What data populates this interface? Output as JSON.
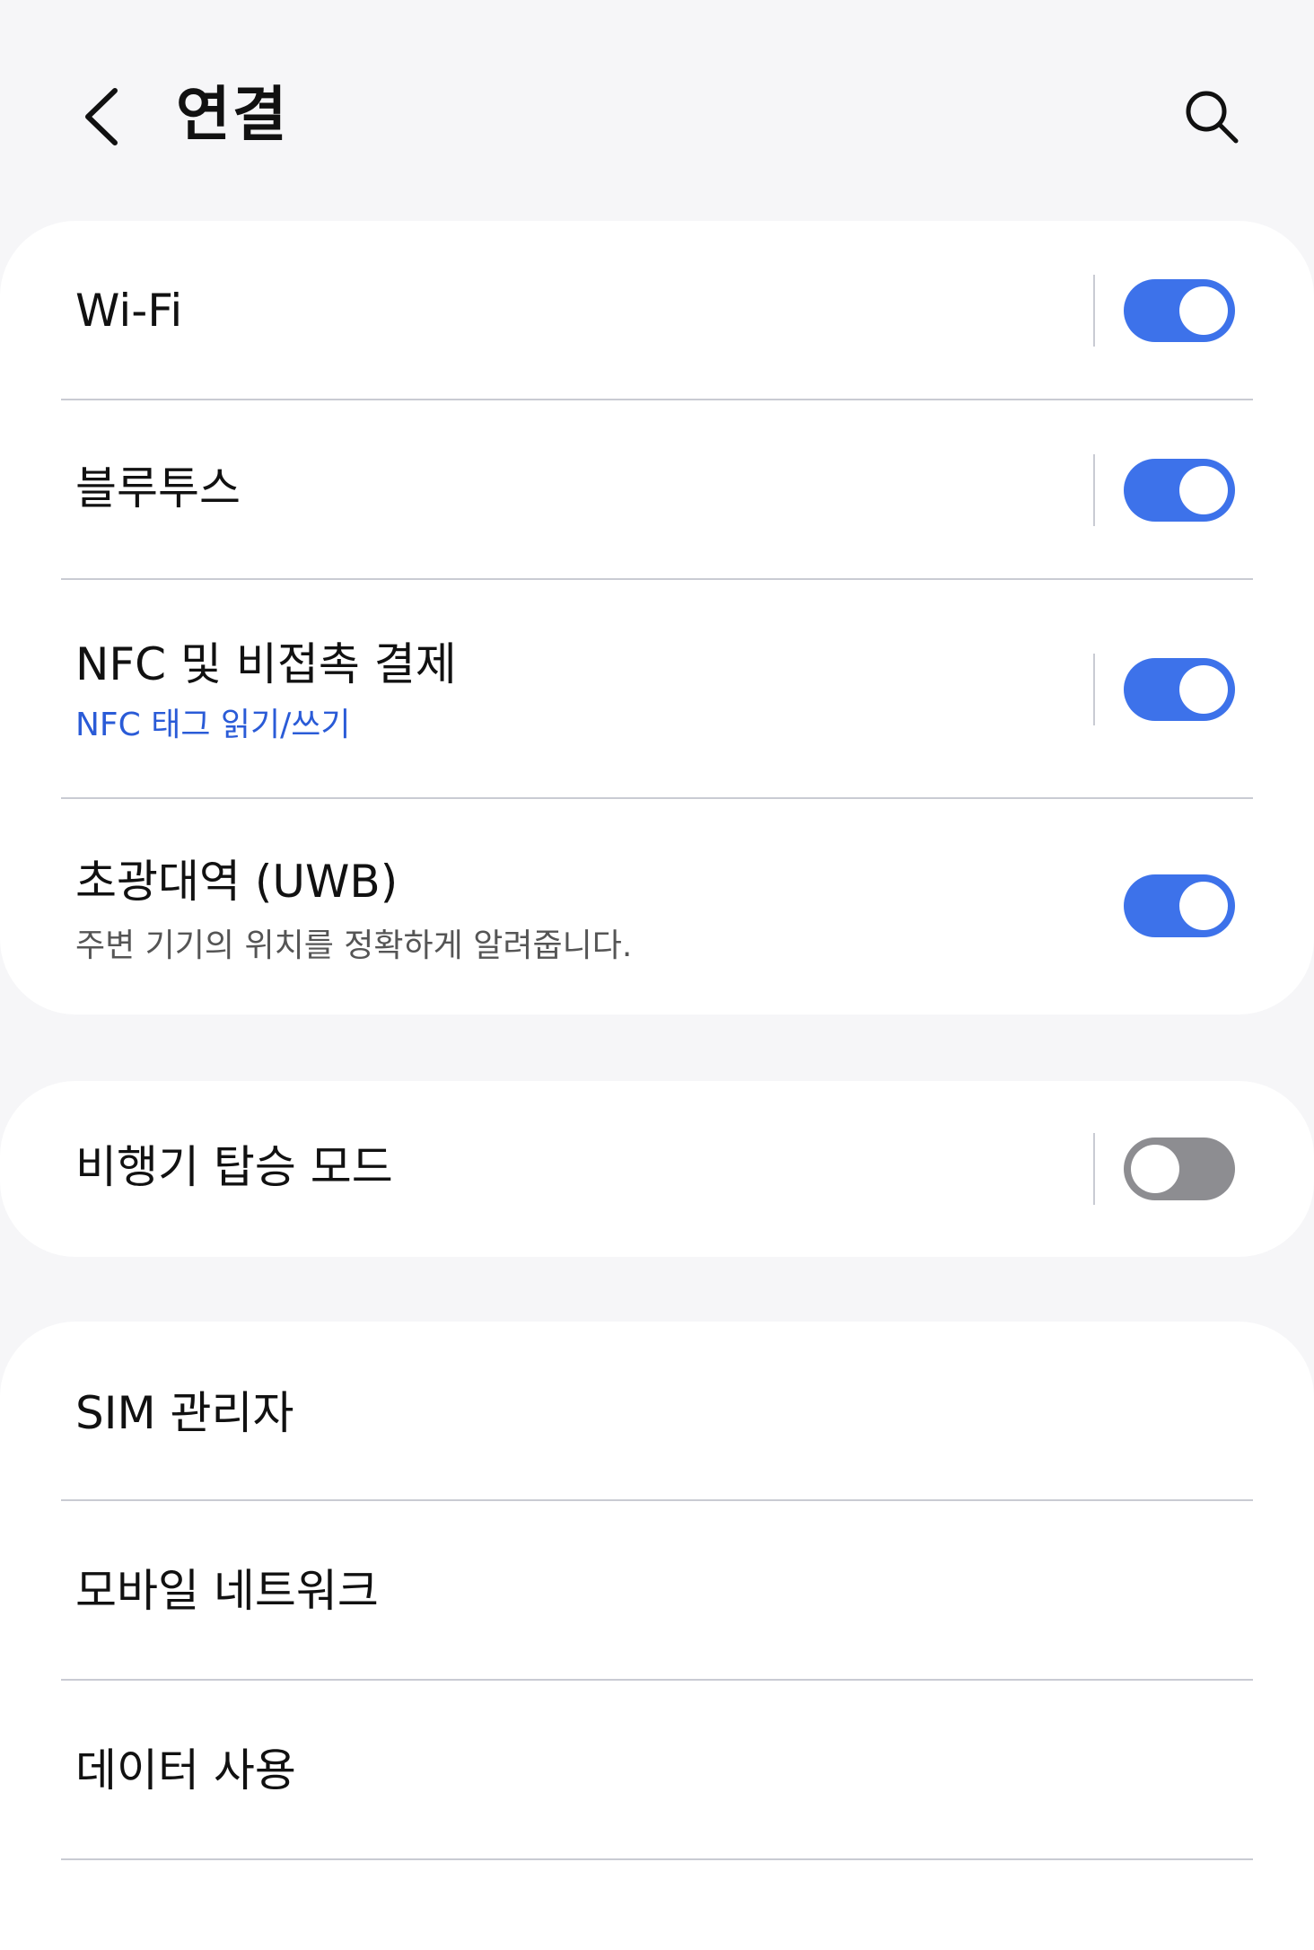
{
  "header": {
    "title": "연결"
  },
  "connections": {
    "wifi": {
      "label": "Wi-Fi",
      "enabled": true
    },
    "bluetooth": {
      "label": "블루투스",
      "enabled": true
    },
    "nfc": {
      "label": "NFC 및 비접촉 결제",
      "sub": "NFC 태그 읽기/쓰기",
      "enabled": true
    },
    "uwb": {
      "label": "초광대역 (UWB)",
      "sub": "주변 기기의 위치를 정확하게 알려줍니다.",
      "enabled": true
    }
  },
  "airplane": {
    "label": "비행기 탑승 모드",
    "enabled": false
  },
  "more": {
    "sim_manager": "SIM 관리자",
    "mobile_networks": "모바일 네트워크",
    "data_usage": "데이터 사용"
  },
  "colors": {
    "accent": "#3d72ea",
    "subtext_blue": "#2a5bd7",
    "switch_off": "#8d8d91",
    "background": "#f6f6f8"
  },
  "icons": {
    "back": "chevron-left-icon",
    "search": "search-icon"
  }
}
